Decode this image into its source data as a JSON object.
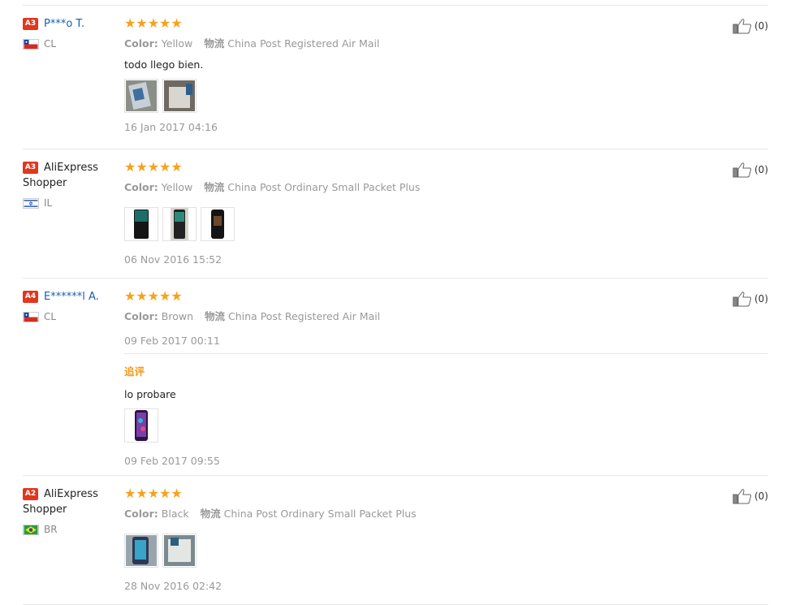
{
  "labels": {
    "logistics": "物流",
    "color": "Color:",
    "followup": "追评"
  },
  "reviews": [
    {
      "level": "A3",
      "name": "P***o T.",
      "country": "CL",
      "stars": "★★★★★",
      "color": "Yellow",
      "logistics": "China Post Registered Air Mail",
      "text": "todo llego bien.",
      "date": "16 Jan 2017 04:16",
      "likes": "(0)"
    },
    {
      "level": "A3",
      "name": "AliExpress Shopper",
      "country": "IL",
      "stars": "★★★★★",
      "color": "Yellow",
      "logistics": "China Post Ordinary Small Packet Plus",
      "date": "06 Nov 2016 15:52",
      "likes": "(0)"
    },
    {
      "level": "A4",
      "name": "E******l A.",
      "country": "CL",
      "stars": "★★★★★",
      "color": "Brown",
      "logistics": "China Post Registered Air Mail",
      "date": "09 Feb 2017 00:11",
      "followup_text": "lo probare",
      "followup_date": "09 Feb 2017 09:55",
      "likes": "(0)"
    },
    {
      "level": "A2",
      "name": "AliExpress Shopper",
      "country": "BR",
      "stars": "★★★★★",
      "color": "Black",
      "logistics": "China Post Ordinary Small Packet Plus",
      "date": "28 Nov 2016 02:42",
      "likes": "(0)"
    }
  ],
  "colors": {
    "level_badge": "#e0371f",
    "stars": "#f6a21e",
    "link": "#1a5fae",
    "followup": "#f19a18"
  }
}
